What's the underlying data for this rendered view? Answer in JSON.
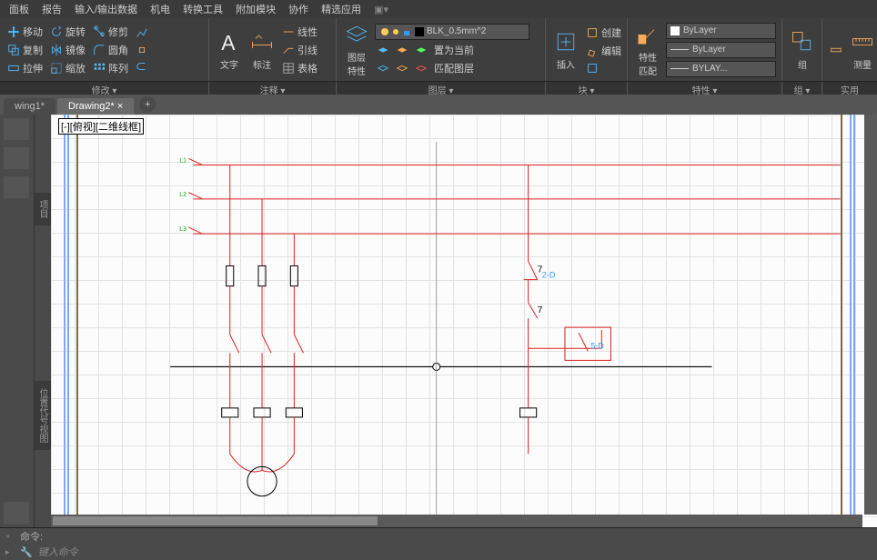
{
  "menubar": [
    "面板",
    "报告",
    "输入/输出数据",
    "机电",
    "转换工具",
    "附加模块",
    "协作",
    "精选应用"
  ],
  "ribbon": {
    "modify": {
      "items": [
        [
          "移动",
          "旋转",
          "修剪"
        ],
        [
          "复制",
          "镜像",
          "圆角"
        ],
        [
          "拉伸",
          "缩放",
          "阵列"
        ]
      ],
      "label": "修改"
    },
    "annotate": {
      "text": "文字",
      "dim": "标注",
      "linear": "线性",
      "leader": "引线",
      "table": "表格",
      "label": "注释"
    },
    "layers": {
      "big": "图层\n特性",
      "dropdown": "BLK_0.5mm^2",
      "setcurrent": "置为当前",
      "match": "匹配图层",
      "label": "图层"
    },
    "block": {
      "insert": "插入",
      "create": "创建",
      "edit": "编辑",
      "label": "块"
    },
    "props": {
      "big": "特性\n匹配",
      "bylayer1": "ByLayer",
      "bylayer2": "ByLayer",
      "bylayer3": "BYLAY...",
      "label": "特性"
    },
    "group": {
      "big": "组",
      "label": "组"
    },
    "measure": {
      "big": "测量",
      "label": "实用"
    }
  },
  "tabs": {
    "t1": "wing1*",
    "t2": "Drawing2*"
  },
  "view_label": "[-][俯视][二维线框]",
  "side": {
    "project": "项目",
    "locview": "位置代号视图"
  },
  "cmd": {
    "label": "命令:",
    "placeholder": "键入命令"
  },
  "chart_data": {
    "type": "diagram",
    "description": "Electrical schematic with three-phase lines L1 L2 L3, three fuses, three NO contacts, three overload rectangles feeding motor M; control circuit with coil, NC contact 2-D, NO contact 5-D"
  }
}
